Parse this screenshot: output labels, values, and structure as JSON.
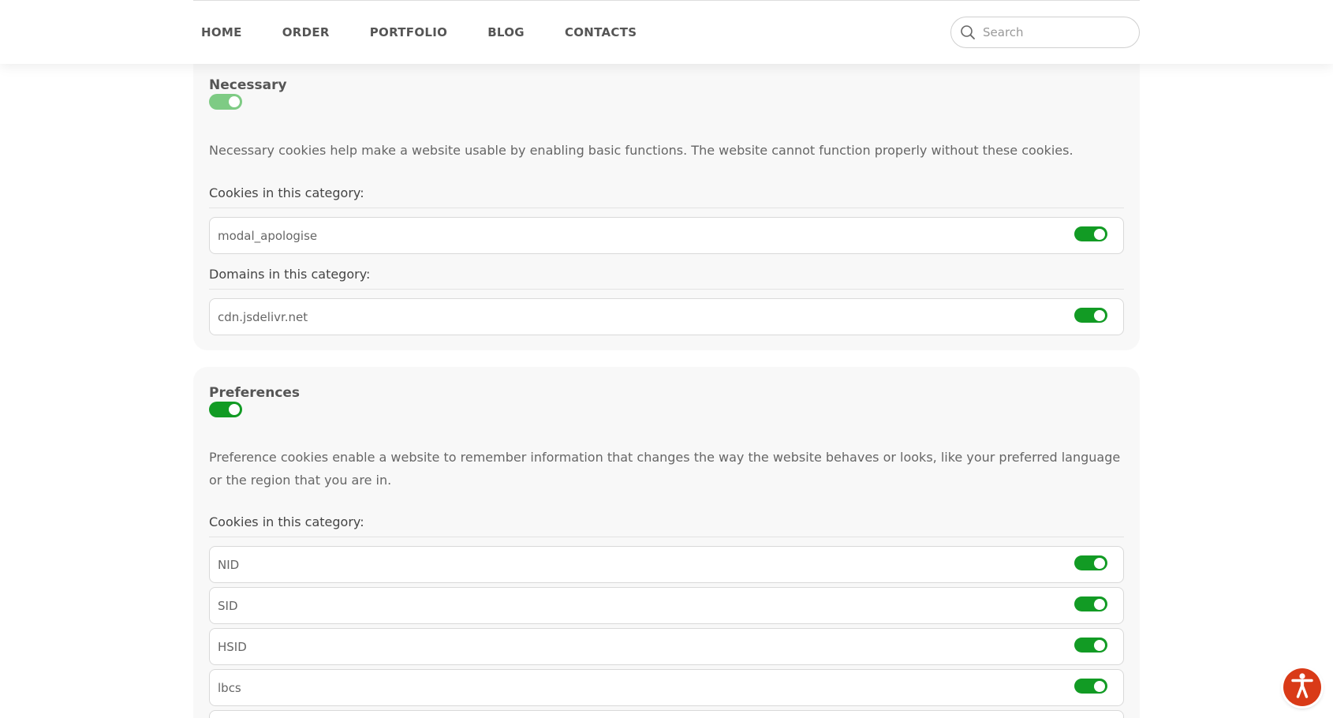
{
  "colors": {
    "toggle_on": "#129b24",
    "toggle_disabled": "#7ecb84",
    "accessibility": "#d93a17"
  },
  "nav": {
    "items": [
      {
        "label": "HOME"
      },
      {
        "label": "ORDER"
      },
      {
        "label": "PORTFOLIO"
      },
      {
        "label": "BLOG"
      },
      {
        "label": "CONTACTS"
      }
    ]
  },
  "search": {
    "placeholder": "Search",
    "icon": "search-icon"
  },
  "categories": [
    {
      "title": "Necessary",
      "toggle_state": "on-disabled",
      "description": "Necessary cookies help make a website usable by enabling basic functions. The website cannot function properly without these cookies.",
      "cookies_label": "Cookies in this category:",
      "cookies": [
        {
          "name": "modal_apologise",
          "enabled": true
        }
      ],
      "domains_label": "Domains in this category:",
      "domains": [
        {
          "name": "cdn.jsdelivr.net",
          "enabled": true
        }
      ]
    },
    {
      "title": "Preferences",
      "toggle_state": "on",
      "description": "Preference cookies enable a website to remember information that changes the way the website behaves or looks, like your preferred language or the region that you are in.",
      "cookies_label": "Cookies in this category:",
      "cookies": [
        {
          "name": "NID",
          "enabled": true
        },
        {
          "name": "SID",
          "enabled": true
        },
        {
          "name": "HSID",
          "enabled": true
        },
        {
          "name": "lbcs",
          "enabled": true
        }
      ]
    }
  ],
  "accessibility_button": {
    "icon": "accessibility-person-icon"
  }
}
